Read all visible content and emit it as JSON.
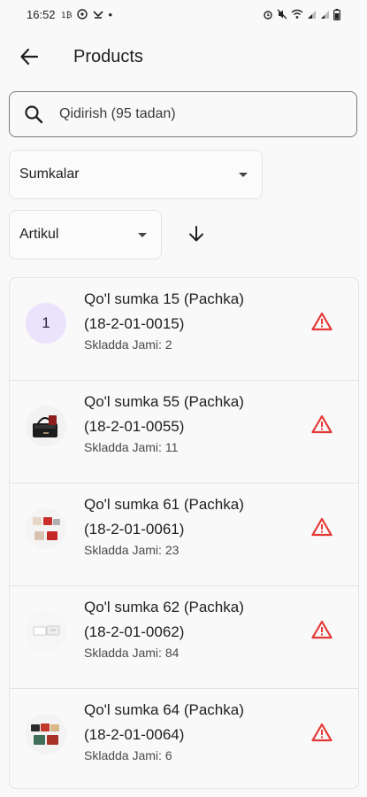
{
  "status_bar": {
    "time": "16:52",
    "left_icons": [
      "data-saver-icon",
      "vpn-icon",
      "missed-call-icon"
    ],
    "dot": "•",
    "right_icons": [
      "alarm-icon",
      "mute-icon",
      "wifi-icon",
      "signal-icon",
      "signal-icon-2",
      "battery-icon"
    ]
  },
  "app_bar": {
    "title": "Products",
    "back_icon": "arrow-left-icon"
  },
  "search": {
    "placeholder": "Qidirish (95 tadan)",
    "icon": "search-icon"
  },
  "filters": {
    "category": {
      "selected": "Sumkalar"
    },
    "sort": {
      "selected": "Artikul"
    },
    "sort_direction_icon": "arrow-down-icon"
  },
  "products": [
    {
      "avatar_letter": "1",
      "title": "Qo'l sumka 15 (Pachka)",
      "code": "(18-2-01-0015)",
      "stock": "Skladda Jami: 2"
    },
    {
      "avatar_letter": "",
      "title": "Qo'l sumka 55 (Pachka)",
      "code": "(18-2-01-0055)",
      "stock": "Skladda Jami: 11"
    },
    {
      "avatar_letter": "",
      "title": "Qo'l sumka 61 (Pachka)",
      "code": "(18-2-01-0061)",
      "stock": "Skladda Jami: 23"
    },
    {
      "avatar_letter": "",
      "title": "Qo'l sumka 62 (Pachka)",
      "code": "(18-2-01-0062)",
      "stock": "Skladda Jami: 84"
    },
    {
      "avatar_letter": "",
      "title": "Qo'l sumka 64 (Pachka)",
      "code": "(18-2-01-0064)",
      "stock": "Skladda Jami: 6"
    }
  ],
  "colors": {
    "warning": "#e53935",
    "avatar_bg": "#ebe2fb"
  }
}
